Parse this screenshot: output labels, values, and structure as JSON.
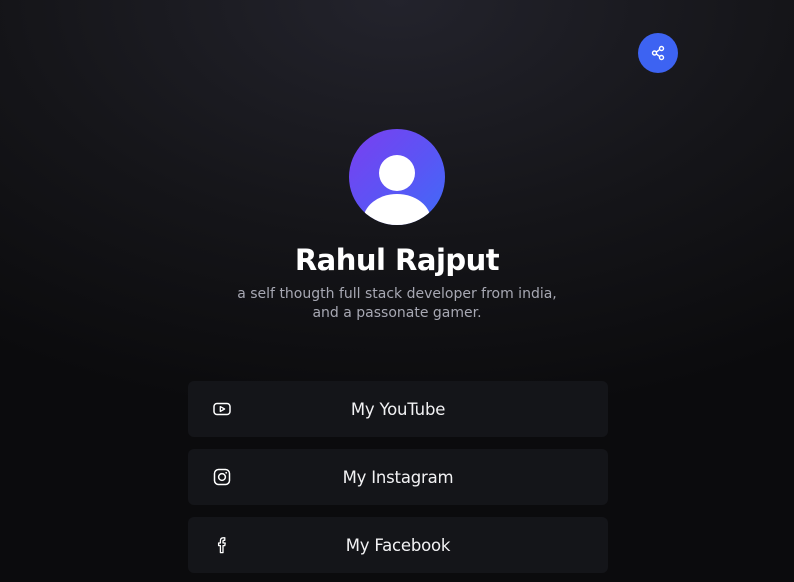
{
  "share": {
    "icon": "share-icon",
    "color": "#3d63f2"
  },
  "profile": {
    "avatar_icon": "user-avatar-icon",
    "name": "Rahul Rajput",
    "bio_line1": "a self thougth full stack developer from india,",
    "bio_line2": "and a passonate gamer."
  },
  "links": [
    {
      "label": "My YouTube",
      "icon": "youtube-icon"
    },
    {
      "label": "My Instagram",
      "icon": "instagram-icon"
    },
    {
      "label": "My Facebook",
      "icon": "facebook-icon"
    }
  ]
}
